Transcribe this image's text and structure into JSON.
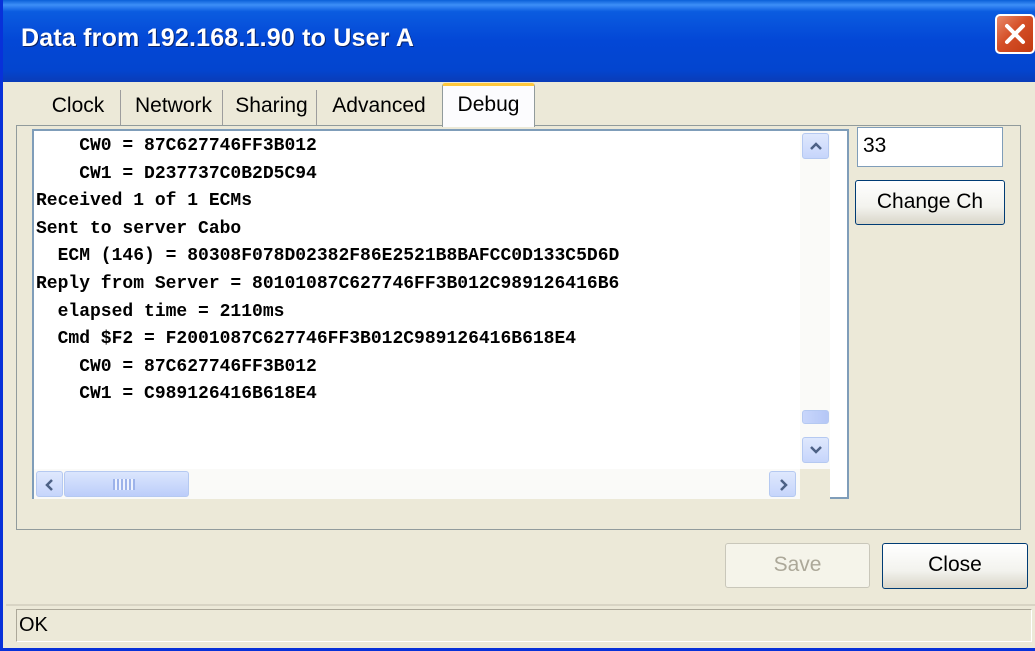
{
  "window": {
    "title": "Data from 192.168.1.90 to User A"
  },
  "tabs": [
    {
      "label": "Clock",
      "active": false
    },
    {
      "label": "Network",
      "active": false
    },
    {
      "label": "Sharing",
      "active": false
    },
    {
      "label": "Advanced",
      "active": false
    },
    {
      "label": "Debug",
      "active": true
    }
  ],
  "debug_log": {
    "lines": [
      "    CW0 = 87C627746FF3B012",
      "    CW1 = D237737C0B2D5C94",
      "Received 1 of 1 ECMs",
      "Sent to server Cabo",
      "  ECM (146) = 80308F078D02382F86E2521B8BAFCC0D133C5D6D",
      "Reply from Server = 80101087C627746FF3B012C989126416B6",
      "  elapsed time = 2110ms",
      "  Cmd $F2 = F2001087C627746FF3B012C989126416B618E4",
      "    CW0 = 87C627746FF3B012",
      "    CW1 = C989126416B618E4"
    ]
  },
  "channel": {
    "value": "33",
    "change_button_label": "Change Ch"
  },
  "buttons": {
    "save_label": "Save",
    "save_enabled": false,
    "close_label": "Close"
  },
  "status": {
    "text": "OK"
  },
  "colors": {
    "titlebar": "#0347d6",
    "close_button": "#d54f27",
    "active_tab_highlight": "#ffc83c",
    "dialog_background": "#ece9d8"
  },
  "icons": {
    "close": "close-x-icon",
    "scroll_up": "arrow-up-icon",
    "scroll_down": "arrow-down-icon",
    "scroll_left": "arrow-left-icon",
    "scroll_right": "arrow-right-icon"
  }
}
